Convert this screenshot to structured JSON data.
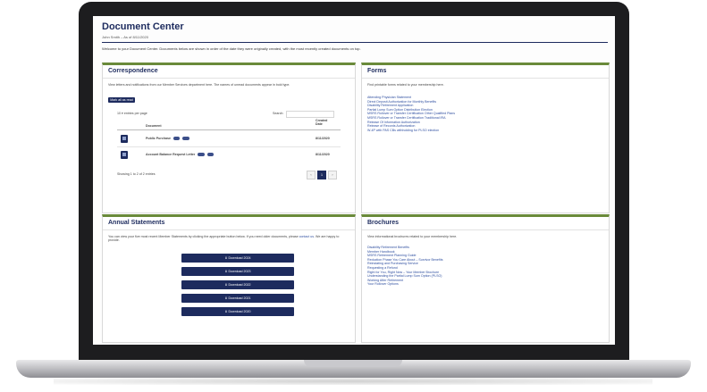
{
  "header": {
    "title": "Document Center",
    "subtitle": "John Smith – As of 8/11/2020",
    "welcome": "Welcome to your Document Center. Documents below are shown in order of the date they were originally created, with the most recently created documents on top."
  },
  "correspondence": {
    "title": "Correspondence",
    "intro": "View letters and notifications from our Member Services department here. The names of unread documents appear in bold type.",
    "mark_all_read": "Mark all as read",
    "entries_label": "entries per page",
    "entries_value": "10",
    "search_label": "Search:",
    "col_document": "Document",
    "col_created": "Created Date",
    "rows": [
      {
        "name": "Public Purchase",
        "date": "8/11/2020"
      },
      {
        "name": "Account Balance Request Letter",
        "date": "8/11/2020"
      }
    ],
    "showing": "Showing 1 to 2 of 2 entries",
    "pagination": {
      "prev": "‹",
      "current": "1",
      "next": "›"
    }
  },
  "forms": {
    "title": "Forms",
    "intro": "Find printable forms related to your membership here.",
    "links": [
      "Attending Physician Statement",
      "Direct Deposit Authorization for Monthly Benefits",
      "Disability Retirement Application",
      "Partial Lump Sum Option Distribution Election",
      "MSRS Rollover or Transfer Certification Other Qualified Plans",
      "MSRS Rollover or Transfer Certification Traditional IRA",
      "Release Of Information Authorization",
      "Release of Records Authorization",
      "W-4P with PAS CBs withholding for PLSO election"
    ]
  },
  "annual_statements": {
    "title": "Annual Statements",
    "intro_before": "You can view your five most recent Member Statements by clicking the appropriate button below. If you need older documents, please",
    "intro_link": "contact us",
    "intro_after": ". We are happy to provide.",
    "buttons": [
      "Download 2024",
      "Download 2023",
      "Download 2022",
      "Download 2021",
      "Download 2020"
    ]
  },
  "brochures": {
    "title": "Brochures",
    "intro": "View informational brochures related to your membership here.",
    "links": [
      "Disability Retirement Benefits",
      "Member Handbook",
      "MSRS Retirement Planning Guide",
      "Reduction Phase You Care About – Survivor Benefits",
      "Reinstating and Purchasing Service",
      "Requesting a Refund",
      "Right for You, Right Now – Your Member Brochure",
      "Understanding the Partial Lump Sum Option (PLSO)",
      "Working After Retirement",
      "Your Rollover Options"
    ]
  },
  "colors": {
    "navy": "#1d2b5e",
    "accent": "#6a8a3a",
    "link": "#2f4fa0"
  },
  "icons": {
    "document": "document-icon",
    "download": "download-icon"
  }
}
